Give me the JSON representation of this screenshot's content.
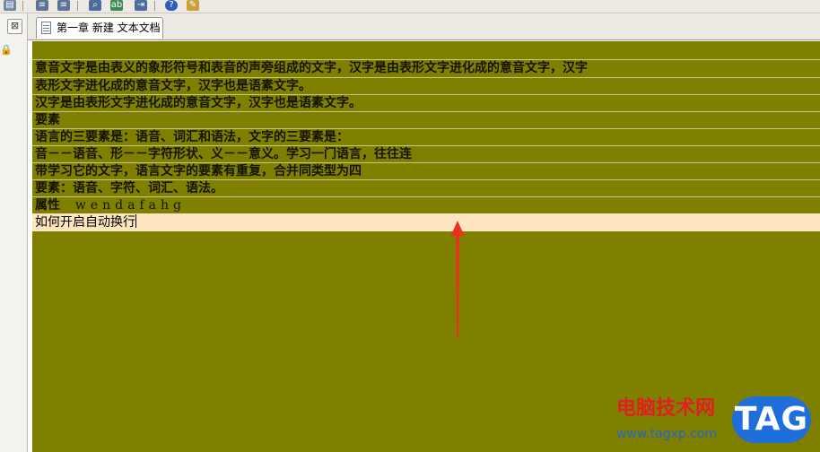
{
  "tab": {
    "label": "第一章 新建 文本文档"
  },
  "left_panel": {
    "close_glyph": "⊠"
  },
  "editor": {
    "background_color": "#808000",
    "current_line_color": "#ffe4c0",
    "lines": [
      "意音文字是由表义的象形符号和表音的声旁组成的文字，汉字是由表形文字进化成的意音文字，汉字",
      "表形文字进化成的意音文字，汉字也是语素文字。",
      "汉字是由表形文字进化成的意音文字，汉字也是语素文字。",
      "要素",
      "语言的三要素是：语音、词汇和语法，文字的三要素是：",
      "音－－语音、形－－字符形状、义－－意义。学习一门语言，往往连",
      "带学习它的文字，语言文字的要素有重复，合并同类型为四",
      "要素：语音、字符、词汇、语法。"
    ],
    "attr_line": {
      "label": "属性",
      "value": "wendafahg"
    },
    "current_line": "如何开启自动换行"
  },
  "watermark": {
    "title": "电脑技术网",
    "url": "www.tagxp.com",
    "logo": "TAG"
  }
}
